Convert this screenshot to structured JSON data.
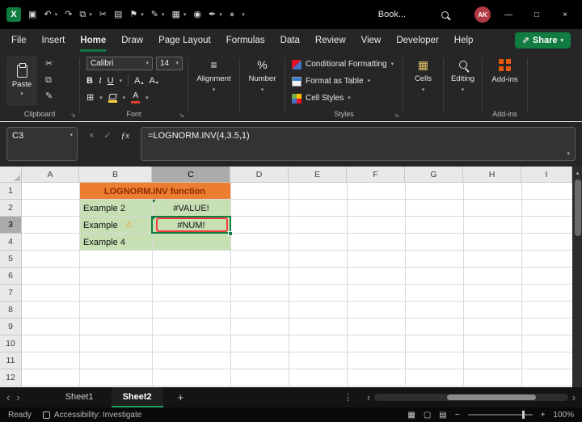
{
  "colors": {
    "accent_green": "#107C41",
    "tab_underline_green": "#21A366",
    "header_orange": "#ED7D31",
    "cell_green": "#C6E0B4",
    "annotation_red": "#F53B3B",
    "avatar_red": "#B13A45",
    "addins_orange": "#E8590C"
  },
  "title_bar": {
    "workbook_name": "Book...",
    "avatar": "AK"
  },
  "menu": {
    "items": [
      "File",
      "Insert",
      "Home",
      "Draw",
      "Page Layout",
      "Formulas",
      "Data",
      "Review",
      "View",
      "Developer",
      "Help"
    ],
    "active": "Home",
    "share": "Share"
  },
  "ribbon": {
    "paste": "Paste",
    "clipboard": "Clipboard",
    "font_name": "Calibri",
    "font_size": "14",
    "bold": "B",
    "italic": "I",
    "underline": "U",
    "font": "Font",
    "alignment": "Alignment",
    "number": "Number",
    "conditional_formatting": "Conditional Formatting",
    "format_as_table": "Format as Table",
    "cell_styles": "Cell Styles",
    "styles": "Styles",
    "cells": "Cells",
    "editing": "Editing",
    "addins": "Add-ins"
  },
  "formula_bar": {
    "name_box": "C3",
    "formula": "=LOGNORM.INV(4,3.5,1)",
    "fx": "ƒx"
  },
  "grid": {
    "columns": [
      "A",
      "B",
      "C",
      "D",
      "E",
      "F",
      "G",
      "H",
      "I"
    ],
    "rows": [
      "1",
      "2",
      "3",
      "4",
      "5",
      "6",
      "7",
      "8",
      "9",
      "10",
      "11",
      "12"
    ],
    "selected_column": "C",
    "selected_row": "3",
    "cells": {
      "title": "LOGNORM.INV function",
      "b2": "Example 2",
      "c2": "#VALUE!",
      "b3": "Example",
      "c3": "#NUM!",
      "b4": "Example 4"
    }
  },
  "sheets": {
    "tabs": [
      "Sheet1",
      "Sheet2"
    ],
    "active": "Sheet2"
  },
  "status": {
    "ready": "Ready",
    "accessibility": "Accessibility: Investigate",
    "zoom": "100%"
  },
  "glyphs": {
    "x": "X",
    "save": "▣",
    "undo": "↶",
    "redo": "↷",
    "copy": "⧉",
    "cut": "✂",
    "pages": "▤",
    "flag": "⚑",
    "brush": "✎",
    "table": "▦",
    "camera": "◉",
    "pen": "✒",
    "record": "●",
    "chevron": "▾",
    "minimize": "—",
    "maximize": "□",
    "close": "×",
    "share_arrow": "⇗",
    "launcher": "⇘",
    "borders": "⊞",
    "align": "≡",
    "percent": "%",
    "a": "A",
    "up": "▴",
    "warning": "⚠",
    "cancel": "×",
    "check": "✓",
    "left": "‹",
    "right": "›",
    "kebab": "⋮",
    "plus": "+",
    "minus": "−",
    "view_normal": "▦",
    "view_layout": "▢",
    "view_break": "▤"
  }
}
